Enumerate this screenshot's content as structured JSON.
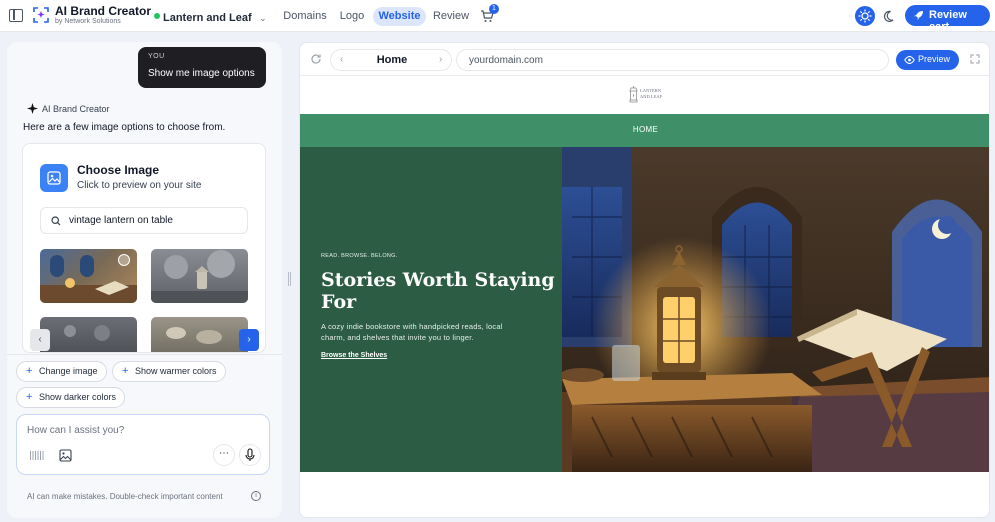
{
  "topbar": {
    "app_title": "AI Brand Creator",
    "app_subtitle": "by Network Solutions",
    "project_name": "Lantern and Leaf",
    "status_color": "#22c55e",
    "nav": [
      {
        "label": "Domains"
      },
      {
        "label": "Logo"
      },
      {
        "label": "Website",
        "active": true
      },
      {
        "label": "Review"
      }
    ],
    "cart_badge": "1",
    "review_cart_label": "Review cart",
    "accent": "#2563eb"
  },
  "chat": {
    "user_tag": "YOU",
    "user_message": "Show me image options",
    "bot_name": "AI Brand Creator",
    "bot_message": "Here are a few image options to choose from.",
    "card": {
      "title": "Choose Image",
      "subtitle": "Click to preview on your site",
      "search_value": "vintage lantern on table"
    },
    "suggestions": [
      {
        "label": "Change image"
      },
      {
        "label": "Show warmer colors"
      },
      {
        "label": "Show darker colors"
      }
    ],
    "input_placeholder": "How can I assist you?",
    "disclaimer": "AI can make mistakes. Double-check important content"
  },
  "browser": {
    "page_tab": "Home",
    "url": "yourdomain.com",
    "preview_label": "Preview"
  },
  "site": {
    "logo_text_line1": "LANTERN",
    "logo_text_line2": "AND LEAF",
    "nav_home": "HOME",
    "nav_color": "#3f8f68",
    "hero_bg": "#2d5c45",
    "eyebrow": "READ. BROWSE. BELONG.",
    "headline_line1": "Stories Worth Staying",
    "headline_line2": "For",
    "description_line1": "A cozy indie bookstore with handpicked reads, local",
    "description_line2": "charm, and shelves that invite you to linger.",
    "cta": "Browse the Shelves"
  }
}
